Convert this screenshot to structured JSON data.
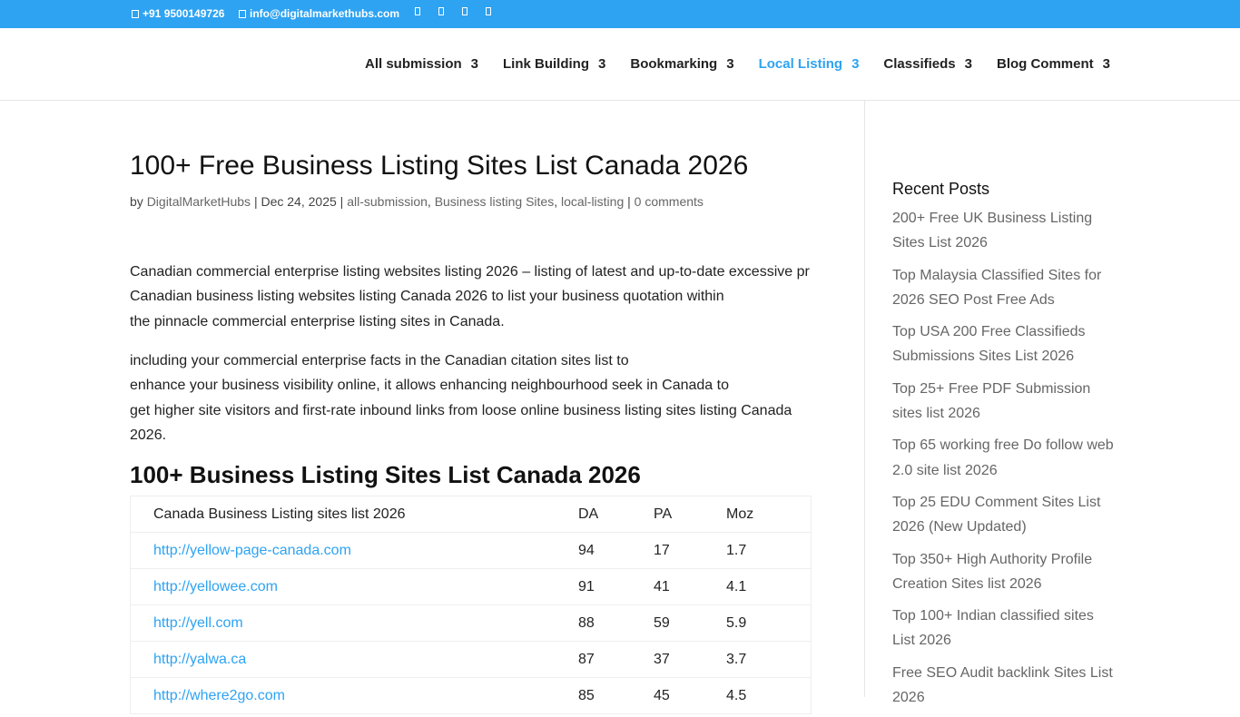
{
  "topbar": {
    "phone": "+91 9500149726",
    "email": "info@digitalmarkethubs.com",
    "social_icons": [
      "facebook-icon",
      "twitter-icon",
      "instagram-icon",
      "linkedin-icon"
    ],
    "background": "#2ea3f2"
  },
  "nav": {
    "items": [
      {
        "label": "All submission",
        "badge": "3"
      },
      {
        "label": "Link Building",
        "badge": "3"
      },
      {
        "label": "Bookmarking",
        "badge": "3"
      },
      {
        "label": "Local Listing",
        "badge": "3",
        "active": true
      },
      {
        "label": "Classifieds",
        "badge": "3"
      },
      {
        "label": "Blog Comment",
        "badge": "3"
      }
    ],
    "accent": "#2ea3f2"
  },
  "post": {
    "title": "100+ Free Business Listing Sites List Canada 2026",
    "meta": {
      "by": "by ",
      "author": "DigitalMarketHubs",
      "sep1": " | ",
      "date": "Dec 24, 2025",
      "sep2": " | ",
      "cat1": "all-submission",
      "comma1": ", ",
      "cat2": "Business listing Sites",
      "comma2": ", ",
      "cat3": "local-listing",
      "sep3": " | ",
      "comments": "0 comments"
    },
    "paragraph1": [
      "Canadian commercial enterprise listing websites listing 2026 – listing of latest and up-to-date excessive pr",
      "Canadian business listing websites listing Canada 2026 to list your business quotation within",
      "the pinnacle commercial enterprise listing sites in Canada."
    ],
    "paragraph2": [
      "including your commercial enterprise facts in the Canadian citation sites list to",
      "enhance your business visibility online, it allows enhancing neighbourhood seek in Canada to",
      "get higher site visitors and first-rate inbound links from loose online business listing sites listing Canada",
      "2026."
    ],
    "section_heading": "100+ Business Listing Sites List Canada 2026",
    "table": {
      "headers": [
        "Canada Business Listing sites list 2026",
        "DA",
        "PA",
        "Moz"
      ],
      "rows": [
        {
          "url": "http://yellow-page-canada.com",
          "da": "94",
          "pa": "17",
          "moz": "1.7"
        },
        {
          "url": "http://yellowee.com",
          "da": "91",
          "pa": "41",
          "moz": "4.1"
        },
        {
          "url": "http://yell.com",
          "da": "88",
          "pa": "59",
          "moz": "5.9"
        },
        {
          "url": "http://yalwa.ca",
          "da": "87",
          "pa": "37",
          "moz": "3.7"
        },
        {
          "url": "http://where2go.com",
          "da": "85",
          "pa": "45",
          "moz": "4.5"
        }
      ]
    }
  },
  "sidebar": {
    "title": "Recent Posts",
    "posts": [
      "200+ Free UK Business Listing Sites List 2026",
      "Top Malaysia Classified Sites for 2026 SEO Post Free Ads",
      "Top USA 200 Free Classifieds Submissions Sites List 2026",
      "Top 25+ Free PDF Submission sites list 2026",
      "Top 65 working free Do follow web 2.0 site list 2026",
      "Top 25 EDU Comment Sites List 2026 (New Updated)",
      "Top 350+ High Authority Profile Creation Sites list 2026",
      "Top 100+ Indian classified sites List 2026",
      "Free SEO Audit backlink Sites List 2026"
    ]
  }
}
